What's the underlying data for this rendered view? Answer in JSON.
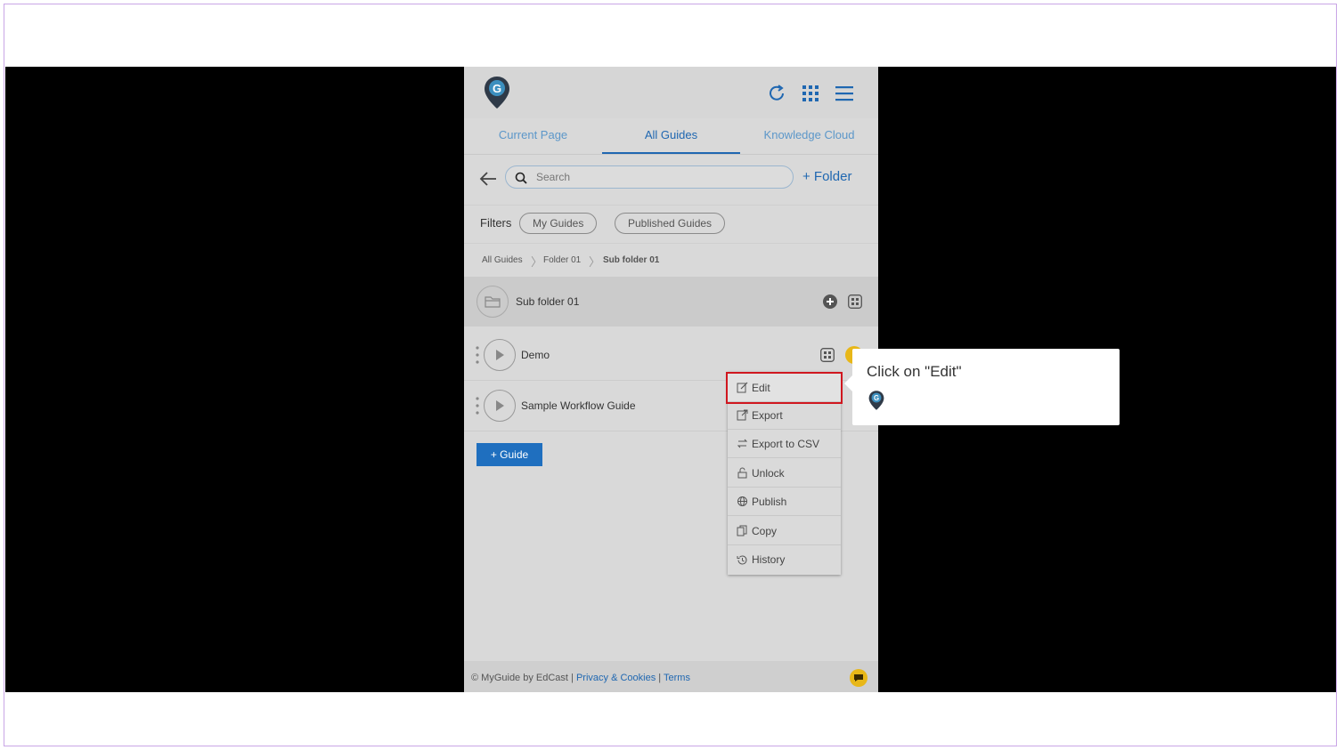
{
  "header": {
    "logo_icon": "myguide-pin-logo",
    "icons": [
      "refresh-icon",
      "apps-grid-icon",
      "hamburger-menu-icon"
    ]
  },
  "tabs": [
    {
      "label": "Current Page",
      "active": false
    },
    {
      "label": "All Guides",
      "active": true
    },
    {
      "label": "Knowledge Cloud",
      "active": false
    }
  ],
  "search": {
    "placeholder": "Search",
    "add_folder_label": "+ Folder"
  },
  "filters": {
    "label": "Filters",
    "chips": [
      "My Guides",
      "Published Guides"
    ]
  },
  "breadcrumb": [
    "All Guides",
    "Folder 01",
    "Sub folder 01"
  ],
  "folder": {
    "name": "Sub folder 01"
  },
  "guides": [
    {
      "name": "Demo"
    },
    {
      "name": "Sample Workflow Guide"
    }
  ],
  "add_guide_label": "+ Guide",
  "context_menu": [
    {
      "label": "Edit",
      "icon": "edit-icon",
      "highlighted": true
    },
    {
      "label": "Export",
      "icon": "export-icon"
    },
    {
      "label": "Export to CSV",
      "icon": "export-csv-icon"
    },
    {
      "label": "Unlock",
      "icon": "unlock-icon"
    },
    {
      "label": "Publish",
      "icon": "publish-globe-icon"
    },
    {
      "label": "Copy",
      "icon": "copy-icon"
    },
    {
      "label": "History",
      "icon": "history-icon"
    }
  ],
  "tooltip": {
    "text": "Click on \"Edit\""
  },
  "footer": {
    "copyright": "© MyGuide by EdCast",
    "sep": "|",
    "privacy": "Privacy & Cookies",
    "terms": "Terms"
  },
  "colors": {
    "accent": "#1f67b1",
    "highlight": "#d0171f",
    "badge": "#e8b718"
  }
}
